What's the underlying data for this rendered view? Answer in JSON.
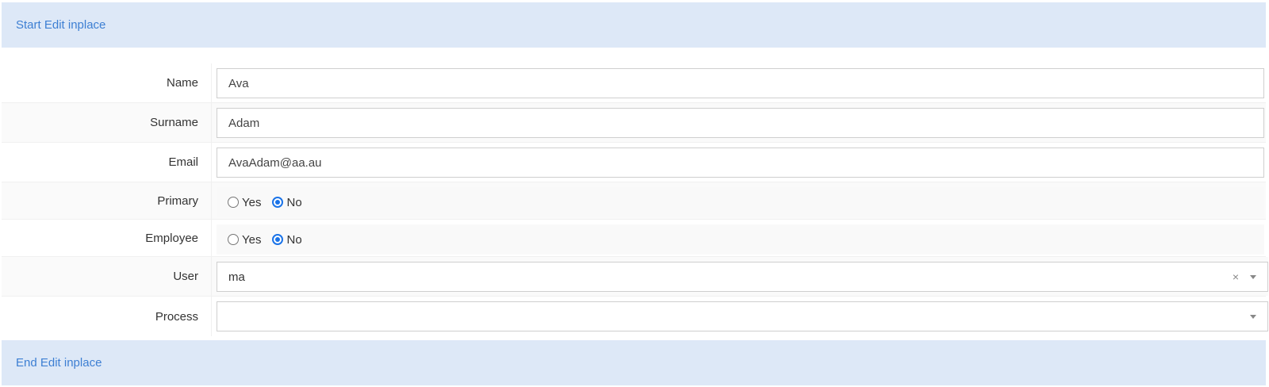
{
  "header": {
    "link_label": "Start Edit inplace"
  },
  "footer": {
    "link_label": "End Edit inplace"
  },
  "form": {
    "name": {
      "label": "Name",
      "value": "Ava"
    },
    "surname": {
      "label": "Surname",
      "value": "Adam"
    },
    "email": {
      "label": "Email",
      "value": "AvaAdam@aa.au"
    },
    "primary": {
      "label": "Primary",
      "options": [
        {
          "label": "Yes",
          "checked": false
        },
        {
          "label": "No",
          "checked": true
        }
      ]
    },
    "employee": {
      "label": "Employee",
      "options": [
        {
          "label": "Yes",
          "checked": false
        },
        {
          "label": "No",
          "checked": true
        }
      ]
    },
    "user": {
      "label": "User",
      "value": "ma",
      "clear_glyph": "×"
    },
    "process": {
      "label": "Process",
      "value": ""
    }
  },
  "colors": {
    "banner_bg": "#dde8f7",
    "link": "#3d7fd3",
    "radio_accent": "#1a73e8"
  }
}
